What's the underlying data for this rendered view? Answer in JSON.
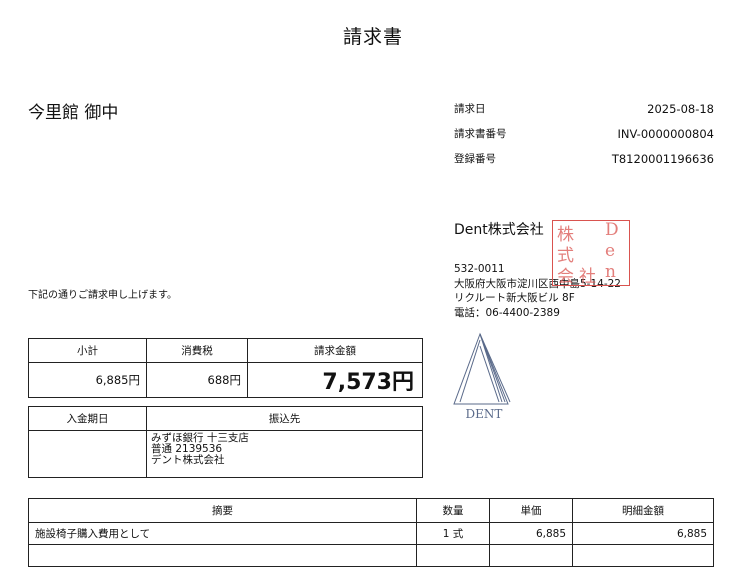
{
  "document": {
    "title": "請求書",
    "recipient": "今里館 御中",
    "intro": "下記の通りご請求申し上げます。"
  },
  "meta": {
    "rows": [
      {
        "label": "請求日",
        "value": "2025-08-18"
      },
      {
        "label": "請求書番号",
        "value": "INV-0000000804"
      },
      {
        "label": "登録番号",
        "value": "T8120001196636"
      }
    ]
  },
  "issuer": {
    "company": "Dent株式会社",
    "postal": "532-0011",
    "address1": "大阪府大阪市淀川区西中島5-14-22",
    "address2": "リクルート新大阪ビル 8F",
    "phone": "電話：06-4400-2389",
    "stamp_text": "株式会社Dent",
    "logo_text": "DENT"
  },
  "summary": {
    "headers": [
      "小計",
      "消費税",
      "請求金額"
    ],
    "subtotal": "6,885円",
    "tax": "688円",
    "total": "7,573円"
  },
  "payment": {
    "headers": [
      "入金期日",
      "振込先"
    ],
    "due": "",
    "bank": [
      "みずほ銀行 十三支店",
      "普通 2139536",
      "デント株式会社"
    ]
  },
  "items": {
    "headers": [
      "摘要",
      "数量",
      "単価",
      "明細金額"
    ],
    "rows": [
      {
        "desc": "施設椅子購入費用として",
        "qty": "1 式",
        "unit": "6,885",
        "amount": "6,885"
      },
      {
        "desc": "",
        "qty": "",
        "unit": "",
        "amount": ""
      }
    ]
  },
  "colors": {
    "stamp": "#d9534f",
    "logo": "#5a6a8a"
  }
}
